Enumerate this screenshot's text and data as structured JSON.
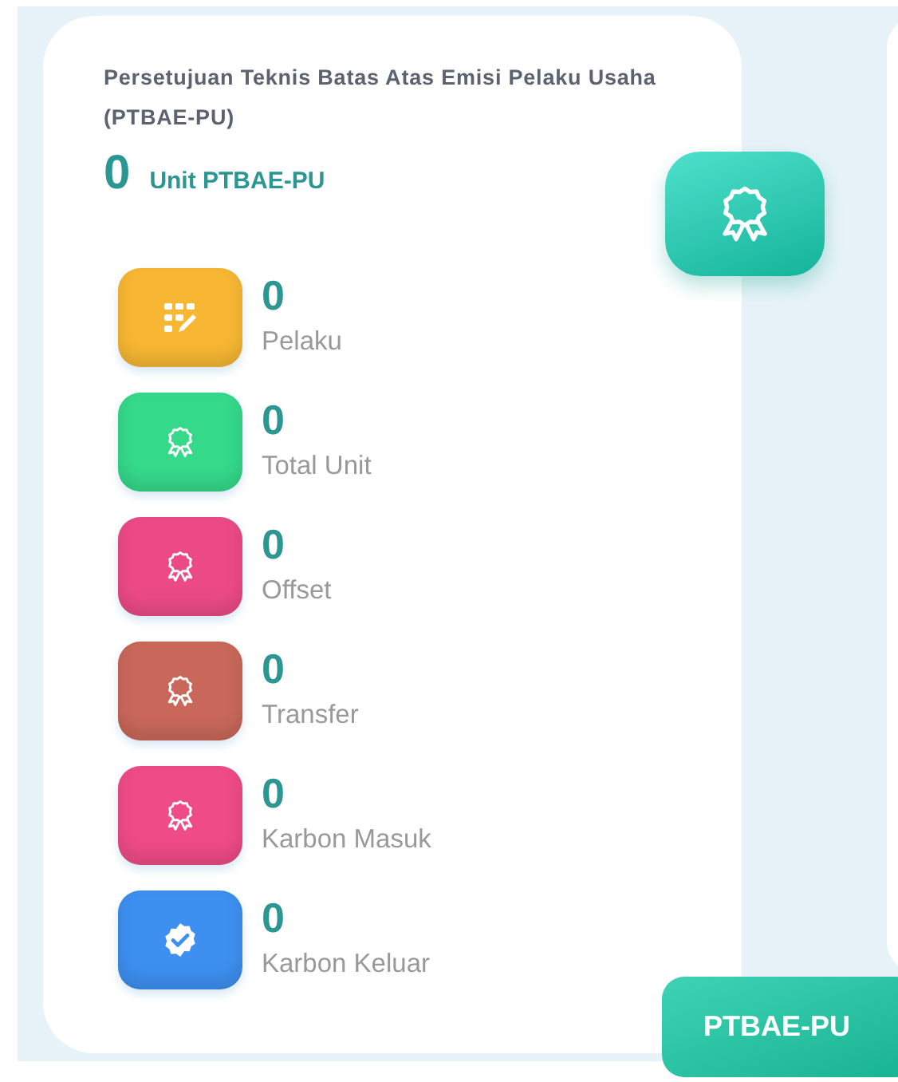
{
  "card": {
    "title": "Persetujuan Teknis Batas Atas Emisi Pelaku Usaha (PTBAE-PU)",
    "total": "0",
    "total_unit": "Unit PTBAE-PU",
    "stats": [
      {
        "value": "0",
        "label": "Pelaku",
        "kind": "grid",
        "color": "#f7b733"
      },
      {
        "value": "0",
        "label": "Total Unit",
        "kind": "award",
        "color": "#35d98a"
      },
      {
        "value": "0",
        "label": "Offset",
        "kind": "award",
        "color": "#ec4a86"
      },
      {
        "value": "0",
        "label": "Transfer",
        "kind": "award",
        "color": "#c9685a"
      },
      {
        "value": "0",
        "label": "Karbon Masuk",
        "kind": "award",
        "color": "#ef4b86"
      },
      {
        "value": "0",
        "label": "Karbon Keluar",
        "kind": "badge",
        "color": "#3d8ff0"
      }
    ]
  },
  "tab_button": "PTBAE-PU"
}
